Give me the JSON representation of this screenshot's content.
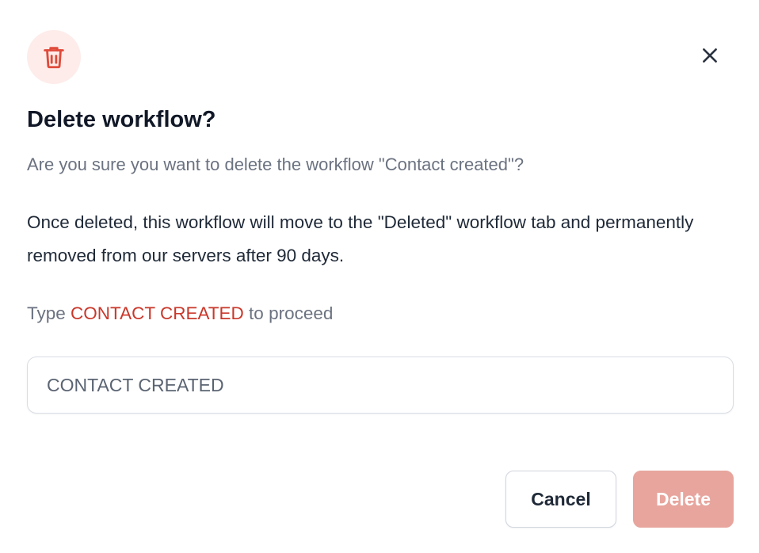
{
  "dialog": {
    "icon": "trash-icon",
    "close_icon": "close-icon",
    "title": "Delete workflow?",
    "subtitle": "Are you sure you want to delete the workflow \"Contact created\"?",
    "body": "Once deleted, this workflow will move to the \"Deleted\" workflow tab and permanently removed from our servers after 90 days.",
    "prompt": {
      "prefix": "Type ",
      "keyword": "CONTACT CREATED",
      "suffix": " to proceed"
    },
    "input": {
      "value": "CONTACT CREATED",
      "placeholder": ""
    },
    "buttons": {
      "cancel_label": "Cancel",
      "delete_label": "Delete"
    }
  },
  "colors": {
    "danger": "#c9382b",
    "danger_soft_bg": "#fdecea",
    "delete_button_bg": "#e7a59d"
  }
}
